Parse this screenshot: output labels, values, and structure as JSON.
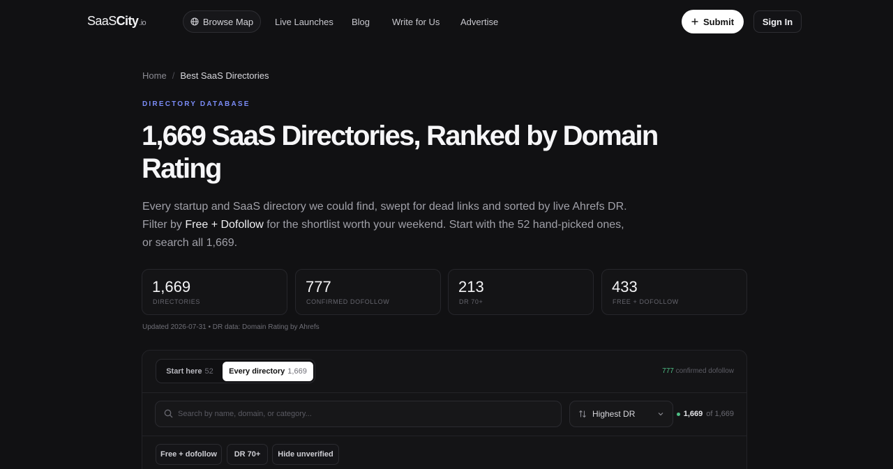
{
  "header": {
    "logo": {
      "part1": "SaaS",
      "part2": "City",
      "part3": ".io"
    },
    "nav": {
      "browse_map": "Browse Map",
      "live_launches": "Live Launches",
      "blog": "Blog",
      "write_for_us": "Write for Us",
      "advertise": "Advertise"
    },
    "submit_label": "Submit",
    "signin_label": "Sign In"
  },
  "breadcrumb": {
    "home": "Home",
    "separator": "/",
    "current": "Best SaaS Directories"
  },
  "hero": {
    "eyebrow": "DIRECTORY DATABASE",
    "title": "1,669 SaaS Directories, Ranked by Domain Rating",
    "lede_1": "Every startup and SaaS directory we could find, swept for dead links and sorted by live Ahrefs DR. Filter by ",
    "lede_highlight": "Free + Dofollow",
    "lede_2": " for the shortlist worth your weekend. Start with the 52 hand-picked ones, or search all 1,669."
  },
  "stats": [
    {
      "value": "1,669",
      "label": "DIRECTORIES"
    },
    {
      "value": "777",
      "label": "CONFIRMED DOFOLLOW"
    },
    {
      "value": "213",
      "label": "DR 70+"
    },
    {
      "value": "433",
      "label": "FREE + DOFOLLOW"
    }
  ],
  "updated": "Updated 2026-07-31 • DR data: Domain Rating by Ahrefs",
  "panel": {
    "tabs": [
      {
        "label": "Start here",
        "count": "52"
      },
      {
        "label": "Every directory",
        "count": "1,669"
      }
    ],
    "dofollow_count": "777",
    "dofollow_text": "confirmed dofollow",
    "search_placeholder": "Search by name, domain, or category...",
    "sort_label": "Highest DR",
    "result_shown": "1,669",
    "result_total": "of 1,669",
    "filters": [
      "Free + dofollow",
      "DR 70+",
      "Hide unverified"
    ]
  },
  "colors": {
    "background": "#111113",
    "accent": "#7b8cf7",
    "success": "#4fbf86"
  }
}
